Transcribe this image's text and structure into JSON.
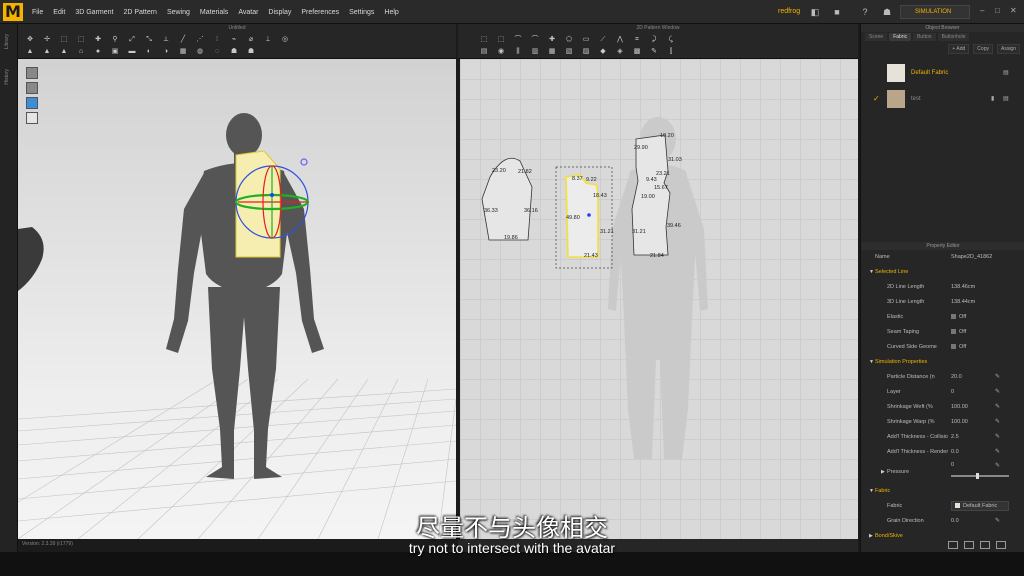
{
  "app": {
    "logo": "M",
    "user": "redfrog",
    "simulation_label": "SIMULATION"
  },
  "menu": [
    "File",
    "Edit",
    "3D Garment",
    "2D Pattern",
    "Sewing",
    "Materials",
    "Avatar",
    "Display",
    "Preferences",
    "Settings",
    "Help"
  ],
  "left_tabs": [
    "Library",
    "History"
  ],
  "window3d": {
    "title": "Untitled",
    "version": "Version: 2.3.39 (r1779)"
  },
  "window2d": {
    "title": "2D Pattern Window"
  },
  "object_browser": {
    "title": "Object Browser",
    "tabs": [
      "Scene",
      "Fabric",
      "Button",
      "Buttonhole"
    ],
    "active_tab": "Fabric",
    "actions": [
      "+ Add",
      "Copy",
      "Assign"
    ],
    "fabrics": [
      {
        "name": "Default Fabric",
        "color": "#e6e2da",
        "name_color": "#f0b400"
      },
      {
        "name": "test",
        "color": "#b8a58a",
        "name_color": "#8a8a8a"
      }
    ]
  },
  "property_editor": {
    "title": "Property Editor",
    "name_label": "Name",
    "name_value": "Shape2D_41862",
    "selected_line": {
      "header": "Selected Line",
      "length2d_label": "2D Line Length",
      "length2d_value": "138.46cm",
      "length3d_label": "3D Line Length",
      "length3d_value": "138.44cm",
      "elastic_label": "Elastic",
      "elastic_value": "Off",
      "seam_label": "Seam Taping",
      "seam_value": "Off",
      "curved_label": "Curved Side Geome",
      "curved_value": "Off"
    },
    "simulation": {
      "header": "Simulation Properties",
      "particle_label": "Particle Distance (n",
      "particle_value": "20.0",
      "layer_label": "Layer",
      "layer_value": "0",
      "weft_label": "Shrinkage Weft (%",
      "weft_value": "100.00",
      "warp_label": "Shrinkage Warp (%",
      "warp_value": "100.00",
      "thick_col_label": "Add'l Thickness - Collisio",
      "thick_col_value": "2.5",
      "thick_ren_label": "Add'l Thickness - Render",
      "thick_ren_value": "0.0",
      "pressure_label": "Pressure",
      "pressure_value": "0",
      "pressure_level": 0.45
    },
    "fabric": {
      "header": "Fabric",
      "fabric_label": "Fabric",
      "fabric_value": "Default Fabric",
      "grain_label": "Grain Direction",
      "grain_value": "0.0"
    },
    "bond_header": "Bond/Skive"
  },
  "patterns": {
    "sleeve": [
      "23.20",
      "21.82",
      "36.33",
      "36.16",
      "19.86"
    ],
    "selected": [
      "8.37",
      "9.22",
      "18.43",
      "49.80",
      "31.21",
      "21.43"
    ],
    "back": [
      "10.20",
      "29.90",
      "31.03",
      "23.21",
      "9.43",
      "15.67",
      "19.00",
      "31.21",
      "39.46",
      "21.84"
    ]
  },
  "subtitles": {
    "chinese": "尽量不与头像相交",
    "english": "try not to intersect with the avatar"
  },
  "colors": {
    "accent": "#f0b400",
    "selection": "#f5e03a",
    "pattern_fill": "#f5eeb0"
  }
}
